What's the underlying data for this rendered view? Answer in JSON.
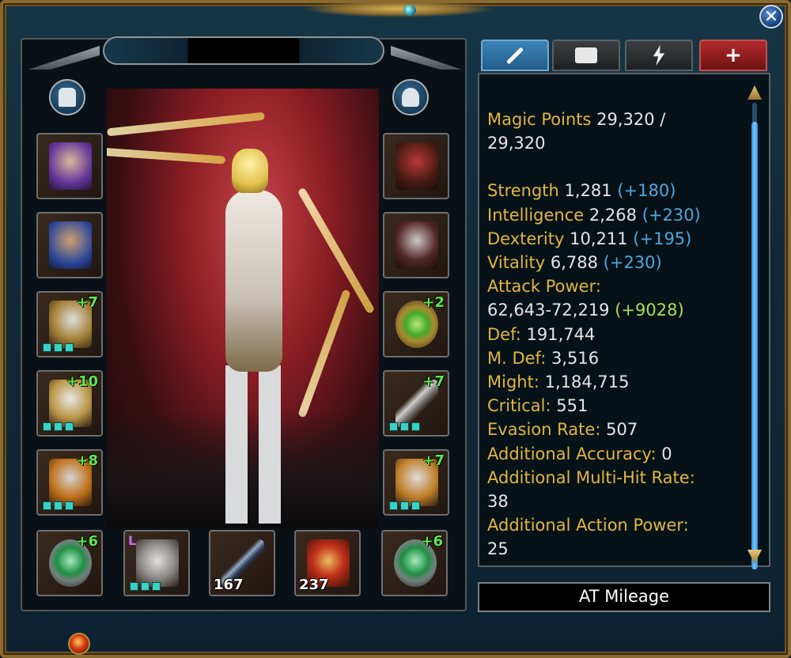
{
  "window": {
    "close_label": "✕"
  },
  "character": {
    "name": ""
  },
  "tabs": [
    {
      "label": "",
      "icon": "sword-icon",
      "active": true
    },
    {
      "label": "",
      "icon": "scroll-icon",
      "active": false
    },
    {
      "label": "",
      "icon": "lightning-icon",
      "active": false
    },
    {
      "label": "+",
      "icon": "plus-icon",
      "active": false
    }
  ],
  "stats": {
    "magic_points": {
      "label": "Magic Points",
      "value": "29,320 /",
      "value2": "29,320"
    },
    "strength": {
      "label": "Strength",
      "value": "1,281",
      "bonus": "(+180)"
    },
    "intelligence": {
      "label": "Intelligence",
      "value": "2,268",
      "bonus": "(+230)"
    },
    "dexterity": {
      "label": "Dexterity",
      "value": "10,211",
      "bonus": "(+195)"
    },
    "vitality": {
      "label": "Vitality",
      "value": "6,788",
      "bonus": "(+230)"
    },
    "attack_power": {
      "label": "Attack Power:",
      "value": "62,643-72,219",
      "bonus": "(+9028)"
    },
    "def": {
      "label": "Def:",
      "value": "191,744"
    },
    "m_def": {
      "label": "M. Def:",
      "value": "3,516"
    },
    "might": {
      "label": "Might:",
      "value": "1,184,715"
    },
    "critical": {
      "label": "Critical:",
      "value": "551"
    },
    "evasion_rate": {
      "label": "Evasion Rate:",
      "value": "507"
    },
    "additional_accuracy": {
      "label": "Additional Accuracy:",
      "value": "0"
    },
    "additional_multi_hit_rate": {
      "label": "Additional Multi-Hit Rate:",
      "value": "38"
    },
    "additional_action_power": {
      "label": "Additional Action Power:",
      "value": "25"
    }
  },
  "mileage_button": "AT Mileage",
  "equipment": {
    "left": [
      {
        "slot": "head",
        "plus": ""
      },
      {
        "slot": "costume",
        "plus": ""
      },
      {
        "slot": "wings",
        "plus": "+7"
      },
      {
        "slot": "armor",
        "plus": "+10"
      },
      {
        "slot": "boots",
        "plus": "+8"
      }
    ],
    "right": [
      {
        "slot": "pet",
        "plus": ""
      },
      {
        "slot": "mount",
        "plus": ""
      },
      {
        "slot": "amulet",
        "plus": "+2"
      },
      {
        "slot": "weapon",
        "plus": "+7"
      },
      {
        "slot": "gloves",
        "plus": "+7"
      }
    ],
    "bottom": [
      {
        "slot": "ring-left",
        "plus": "+6"
      },
      {
        "slot": "accessory",
        "grade": "L"
      },
      {
        "slot": "arrows",
        "count": "167"
      },
      {
        "slot": "potion",
        "count": "237"
      },
      {
        "slot": "ring-right",
        "plus": "+6"
      }
    ]
  },
  "colors": {
    "label": "#e1b542",
    "bonus": "#4fa6de",
    "bonus_green": "#a4e05c",
    "enchant": "#5ee84f"
  }
}
